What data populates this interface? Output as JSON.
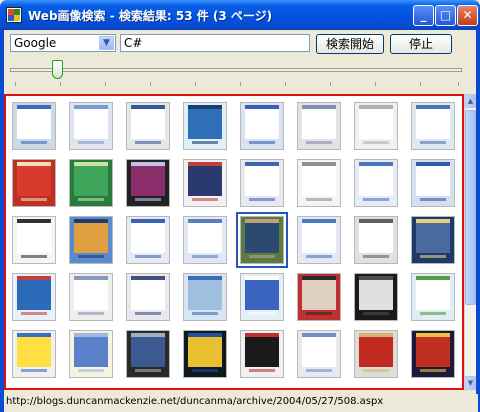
{
  "window": {
    "title": "Web画像検索 - 検索結果: 53 件 (3 ページ)",
    "minimize_glyph": "_",
    "maximize_glyph": "□",
    "close_glyph": "✕"
  },
  "search": {
    "engine": "Google",
    "query": "C#",
    "start_label": "検索開始",
    "stop_label": "停止"
  },
  "slider": {
    "value_fraction": 0.11
  },
  "status": {
    "url": "http://blogs.duncanmackenzie.net/duncanma/archive/2004/05/27/508.aspx"
  },
  "thumbnails": {
    "selected_index": 20,
    "colors": [
      [
        "#cfd8e6",
        "#ffffff",
        "#3a6cc2"
      ],
      [
        "#dfe4ee",
        "#ffffff",
        "#7a9bd1"
      ],
      [
        "#e6e6e6",
        "#ffffff",
        "#3558a0"
      ],
      [
        "#dff0fa",
        "#2f6fb8",
        "#1a3d70"
      ],
      [
        "#d9e2f3",
        "#ffffff",
        "#3a5fb2"
      ],
      [
        "#e3e3e3",
        "#ffffff",
        "#8090b0"
      ],
      [
        "#f0f0f0",
        "#ffffff",
        "#b0b0b0"
      ],
      [
        "#e0e8f0",
        "#ffffff",
        "#4a74b6"
      ],
      [
        "#c03020",
        "#d83b2c",
        "#f0e0c0"
      ],
      [
        "#2a7a40",
        "#3fa55a",
        "#c8e6a0"
      ],
      [
        "#222222",
        "#8a2f6b",
        "#c0c0e8"
      ],
      [
        "#f2f2f2",
        "#2a3a70",
        "#c04040"
      ],
      [
        "#e8e8f0",
        "#ffffff",
        "#4066b0"
      ],
      [
        "#f4f4f4",
        "#ffffff",
        "#909090"
      ],
      [
        "#e5ecf5",
        "#ffffff",
        "#4a76c0"
      ],
      [
        "#d4dfef",
        "#ffffff",
        "#2f5ea8"
      ],
      [
        "#f5f5f5",
        "#ffffff",
        "#333333"
      ],
      [
        "#5a8ad0",
        "#e0a040",
        "#203c70"
      ],
      [
        "#e6eaf2",
        "#ffffff",
        "#3a64b0"
      ],
      [
        "#dfe8f4",
        "#ffffff",
        "#5a7ec4"
      ],
      [
        "#5a7a40",
        "#2a4a70",
        "#c0a080"
      ],
      [
        "#e2e9f4",
        "#ffffff",
        "#4f78c2"
      ],
      [
        "#e0e0e0",
        "#ffffff",
        "#606060"
      ],
      [
        "#1e3a6a",
        "#4a6aa0",
        "#e8d080"
      ],
      [
        "#e8f0fa",
        "#2a6ab8",
        "#c04040"
      ],
      [
        "#eeeeee",
        "#ffffff",
        "#8898b8"
      ],
      [
        "#e8e8ee",
        "#ffffff",
        "#405080"
      ],
      [
        "#d8e6f4",
        "#a0c0e0",
        "#3a6cb8"
      ],
      [
        "#e6eef8",
        "#3a64c0",
        "#ffffff"
      ],
      [
        "#c03030",
        "#e0d0c0",
        "#2a2a2a"
      ],
      [
        "#1a1a1a",
        "#e0e0e0",
        "#505050"
      ],
      [
        "#e0ecf6",
        "#ffffff",
        "#50a040"
      ],
      [
        "#f0f0f0",
        "#ffe040",
        "#3a6cc0"
      ],
      [
        "#f4f4e0",
        "#5a80c8",
        "#a0b8e0"
      ],
      [
        "#2a2a2a",
        "#3a5a90",
        "#a0b0c0"
      ],
      [
        "#101820",
        "#e8c030",
        "#2050a0"
      ],
      [
        "#f0f0f0",
        "#1a1a1a",
        "#c03030"
      ],
      [
        "#e8e8f0",
        "#ffffff",
        "#7090c0"
      ],
      [
        "#dcdcdc",
        "#c02a20",
        "#d8b070"
      ],
      [
        "#1a1a3a",
        "#c03020",
        "#f0c040"
      ]
    ]
  }
}
